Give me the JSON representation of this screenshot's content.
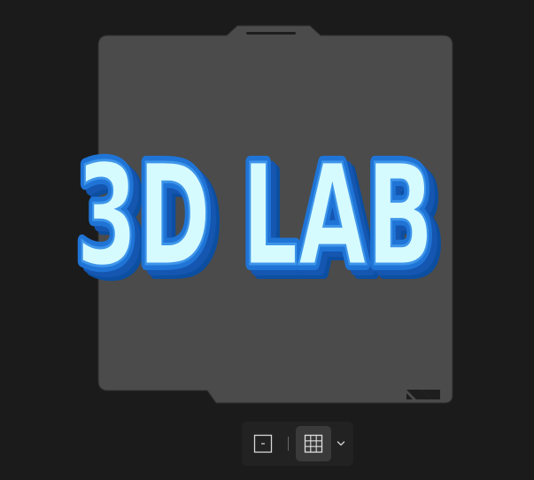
{
  "canvas": {
    "background_color": "#1b1b1b",
    "bed_color": "#4b4b4b",
    "bed_edge_color": "#2e2e2e",
    "bed_label": "3D LAB",
    "label_fill_color": "#d6fbff",
    "label_outline_color": "#1f74d6",
    "label_shadow_color": "#0c4ea0"
  },
  "toolbar": {
    "background_color": "#222222",
    "active_button_color": "#3a3a3a",
    "view_icon": "view-frame-icon",
    "grid_icon": "grid-icon",
    "dropdown_icon": "chevron-down-icon"
  }
}
